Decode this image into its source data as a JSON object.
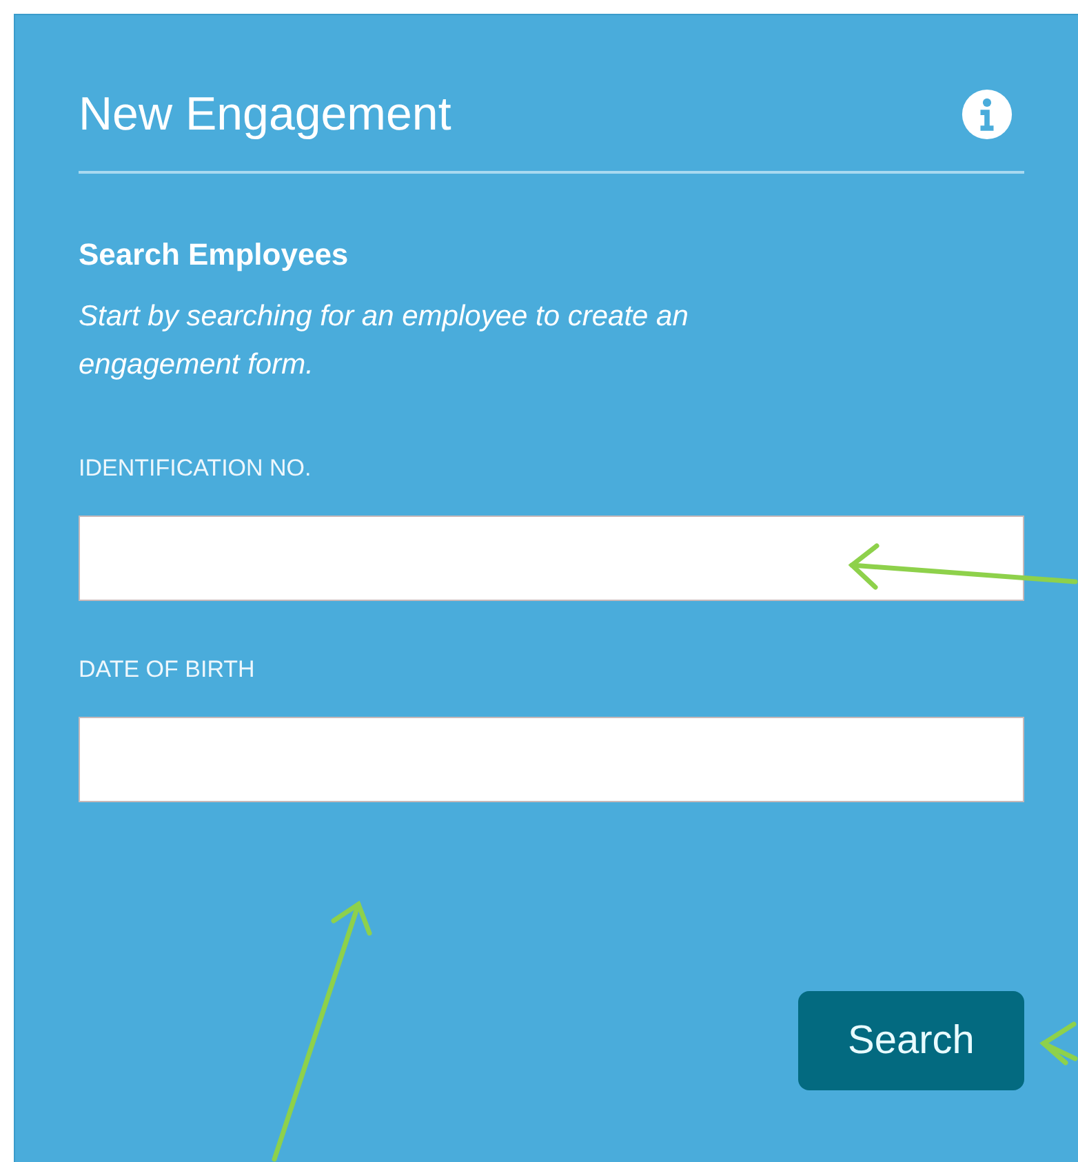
{
  "panel": {
    "title": "New Engagement",
    "section_heading": "Search Employees",
    "description": "Start by searching for an employee to create an engagement form.",
    "fields": [
      {
        "label": "IDENTIFICATION NO."
      },
      {
        "label": "DATE OF BIRTH"
      }
    ],
    "button": "Search"
  }
}
